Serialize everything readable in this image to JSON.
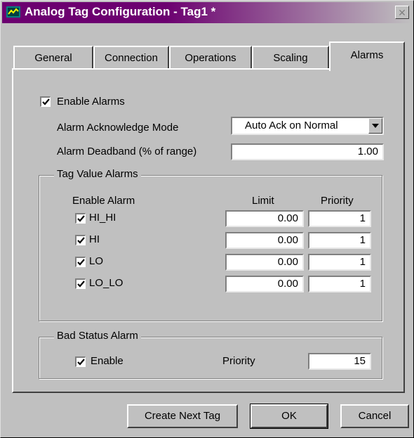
{
  "window": {
    "title": "Analog Tag Configuration - Tag1 *",
    "icon": "analog-tag-icon",
    "close_icon": "close-icon"
  },
  "tabs": [
    {
      "label": "General",
      "active": false
    },
    {
      "label": "Connection",
      "active": false
    },
    {
      "label": "Operations",
      "active": false
    },
    {
      "label": "Scaling",
      "active": false
    },
    {
      "label": "Alarms",
      "active": true
    }
  ],
  "alarms": {
    "enable_label": "Enable Alarms",
    "enable_checked": true,
    "ack_mode_label": "Alarm Acknowledge Mode",
    "ack_mode_value": "Auto Ack on Normal",
    "deadband_label": "Alarm Deadband (% of range)",
    "deadband_value": "1.00"
  },
  "tag_value_alarms": {
    "title": "Tag Value Alarms",
    "col_enable": "Enable Alarm",
    "col_limit": "Limit",
    "col_priority": "Priority",
    "rows": [
      {
        "name": "HI_HI",
        "checked": true,
        "limit": "0.00",
        "priority": "1"
      },
      {
        "name": "HI",
        "checked": true,
        "limit": "0.00",
        "priority": "1"
      },
      {
        "name": "LO",
        "checked": true,
        "limit": "0.00",
        "priority": "1"
      },
      {
        "name": "LO_LO",
        "checked": true,
        "limit": "0.00",
        "priority": "1"
      }
    ]
  },
  "bad_status": {
    "title": "Bad Status Alarm",
    "enable_label": "Enable",
    "enable_checked": true,
    "priority_label": "Priority",
    "priority_value": "15"
  },
  "buttons": {
    "create_next": "Create Next Tag",
    "ok": "OK",
    "cancel": "Cancel"
  },
  "colors": {
    "title_bar": "#6c0070",
    "face": "#c0c0c0"
  }
}
